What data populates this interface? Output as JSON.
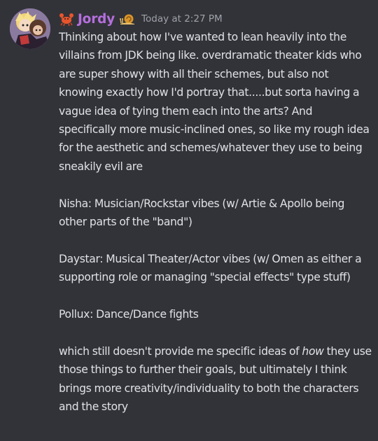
{
  "message": {
    "author": "Jordy",
    "timestamp": "Today at 2:27 PM",
    "author_color": "#b66fde",
    "icons": [
      "crab-icon",
      "snail-icon"
    ],
    "paragraphs": [
      "Thinking about how I've wanted to lean heavily into the villains from JDK being like. overdramatic theater kids who are super showy with all their schemes, but also not knowing exactly how I'd portray that.....but sorta having a vague idea of tying them each into the arts? And specifically more music-inclined ones, so like my rough idea for the aesthetic and schemes/whatever they use to being sneakily evil are",
      "Nisha: Musician/Rockstar vibes (w/ Artie & Apollo being other parts of the \"band\")",
      "Daystar: Musical Theater/Actor vibes (w/ Omen as either a supporting role or managing \"special effects\" type stuff)",
      "Pollux: Dance/Dance fights"
    ],
    "last_paragraph": {
      "before": "which still doesn't provide me specific ideas of ",
      "emphasis": "how",
      "after": " they use those things to further their goals, but ultimately I think brings more creativity/individuality to both the characters and the story"
    }
  }
}
